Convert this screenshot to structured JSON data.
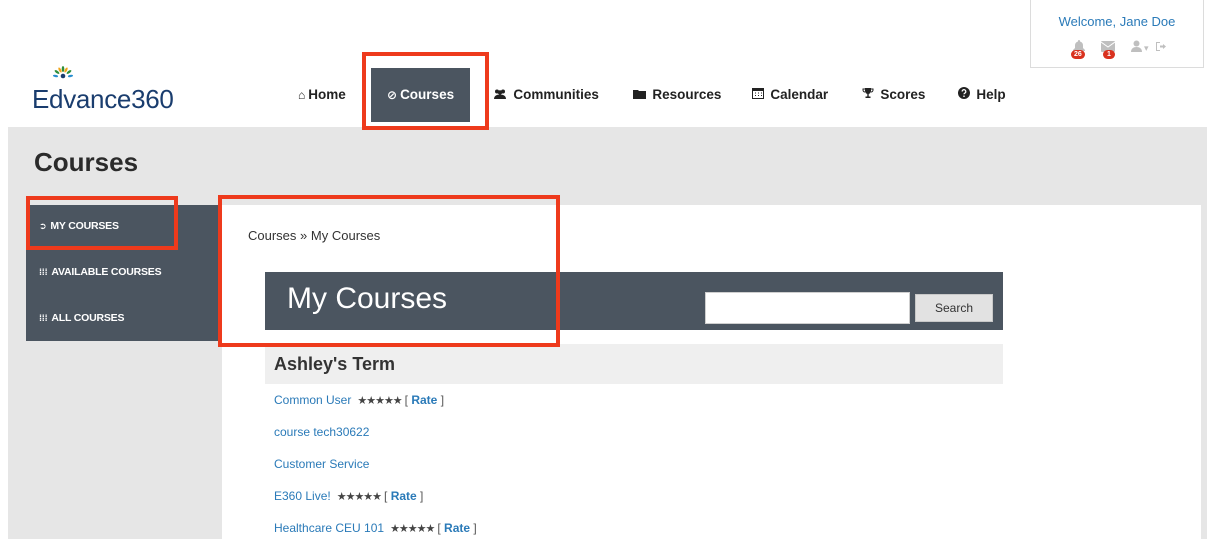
{
  "welcome": {
    "text": "Welcome, Jane Doe",
    "notifications_count": "26",
    "messages_count": "1",
    "icons": [
      "bell-icon",
      "envelope-icon",
      "user-icon",
      "caret-down-icon",
      "sign-out-icon"
    ]
  },
  "logo": {
    "text": "Edvance360"
  },
  "nav": [
    {
      "label": "Home",
      "icon": "home-icon"
    },
    {
      "label": "Courses",
      "icon": "compass-icon",
      "active": true
    },
    {
      "label": "Communities",
      "icon": "users-icon"
    },
    {
      "label": "Resources",
      "icon": "folder-icon"
    },
    {
      "label": "Calendar",
      "icon": "calendar-icon"
    },
    {
      "label": "Scores",
      "icon": "trophy-icon"
    },
    {
      "label": "Help",
      "icon": "question-icon"
    }
  ],
  "page": {
    "title": "Courses"
  },
  "sidebar": {
    "items": [
      {
        "label": "MY COURSES",
        "icon": "chevron-circle-right-icon"
      },
      {
        "label": "AVAILABLE COURSES",
        "icon": "grid-icon"
      },
      {
        "label": "ALL COURSES",
        "icon": "grid-icon"
      }
    ]
  },
  "breadcrumb": {
    "root": "Courses",
    "separator": "»",
    "current": "My Courses"
  },
  "main": {
    "heading": "My Courses",
    "search_button": "Search",
    "search_placeholder": "",
    "term": "Ashley's Term",
    "courses": [
      {
        "name": "Common User",
        "stars": "★★★★★",
        "rate": "Rate"
      },
      {
        "name": "course tech30622"
      },
      {
        "name": "Customer Service"
      },
      {
        "name": "E360 Live!",
        "stars": "★★★★★",
        "rate": "Rate"
      },
      {
        "name": "Healthcare CEU 101",
        "stars": "★★★★★",
        "rate": "Rate"
      }
    ]
  },
  "colors": {
    "nav_active_bg": "#4b5560",
    "highlight": "#ee3a1c",
    "link": "#2a7ab8",
    "band": "#e6e6e6"
  }
}
